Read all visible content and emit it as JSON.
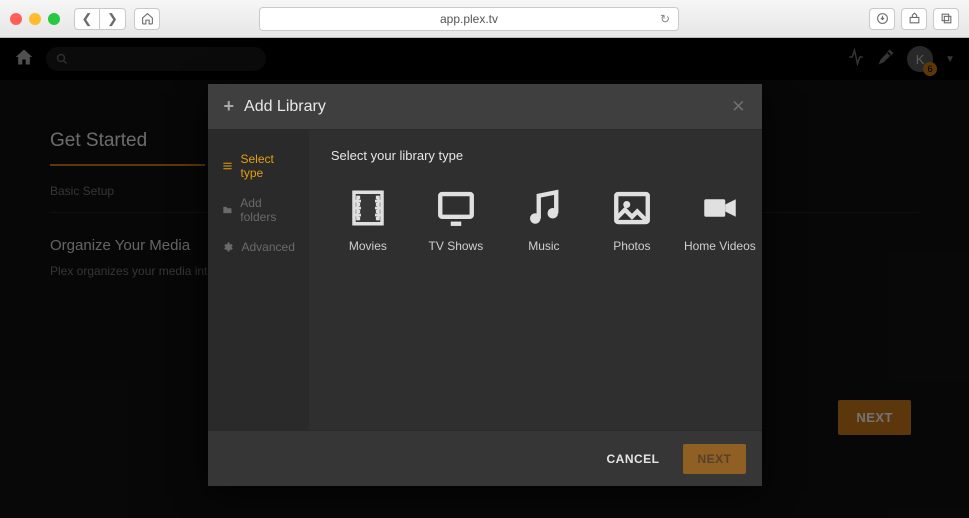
{
  "browser": {
    "url": "app.plex.tv"
  },
  "header": {
    "avatar_letter": "K",
    "badge_count": "6"
  },
  "page": {
    "title": "Get Started",
    "sub": "Basic Setup",
    "section_title": "Organize Your Media",
    "section_desc": "Plex organizes your media into",
    "next_label": "NEXT"
  },
  "modal": {
    "title": "Add Library",
    "steps": [
      {
        "label": "Select type"
      },
      {
        "label": "Add folders"
      },
      {
        "label": "Advanced"
      }
    ],
    "prompt": "Select your library type",
    "types": [
      {
        "label": "Movies"
      },
      {
        "label": "TV Shows"
      },
      {
        "label": "Music"
      },
      {
        "label": "Photos"
      },
      {
        "label": "Home Videos"
      }
    ],
    "cancel": "CANCEL",
    "next": "NEXT"
  }
}
